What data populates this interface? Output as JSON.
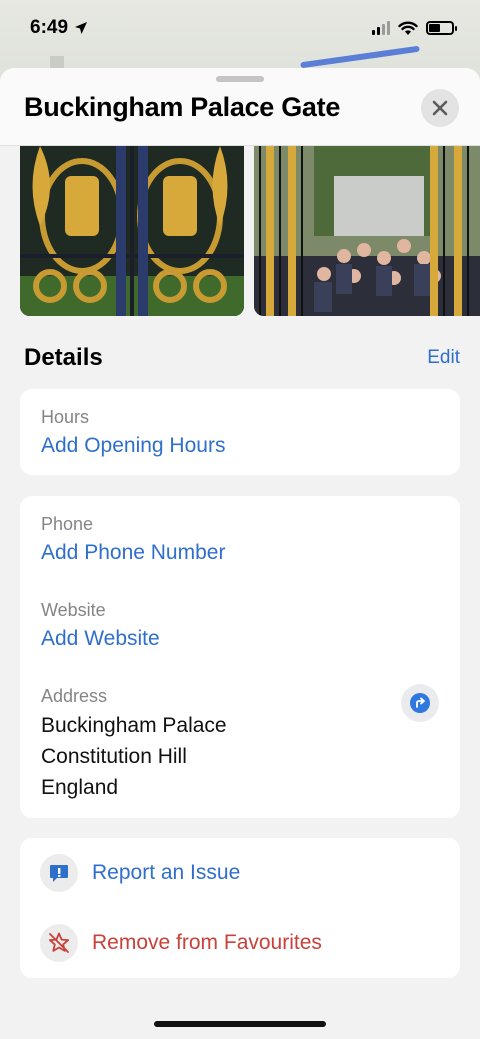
{
  "status_bar": {
    "time": "6:49"
  },
  "place": {
    "title": "Buckingham Palace Gate"
  },
  "details": {
    "heading": "Details",
    "edit_label": "Edit",
    "hours": {
      "label": "Hours",
      "action": "Add Opening Hours"
    },
    "phone": {
      "label": "Phone",
      "action": "Add Phone Number"
    },
    "website": {
      "label": "Website",
      "action": "Add Website"
    },
    "address": {
      "label": "Address",
      "line1": "Buckingham Palace",
      "line2": "Constitution Hill",
      "line3": "England"
    }
  },
  "actions": {
    "report": "Report an Issue",
    "remove_favourite": "Remove from Favourites"
  },
  "colors": {
    "link": "#2f6fcc",
    "destructive": "#c9413a",
    "directions": "#2f78e0"
  },
  "icons": [
    "location-arrow-icon",
    "signal-icon",
    "wifi-icon",
    "battery-icon",
    "close-icon",
    "directions-icon",
    "report-icon",
    "star-remove-icon"
  ]
}
